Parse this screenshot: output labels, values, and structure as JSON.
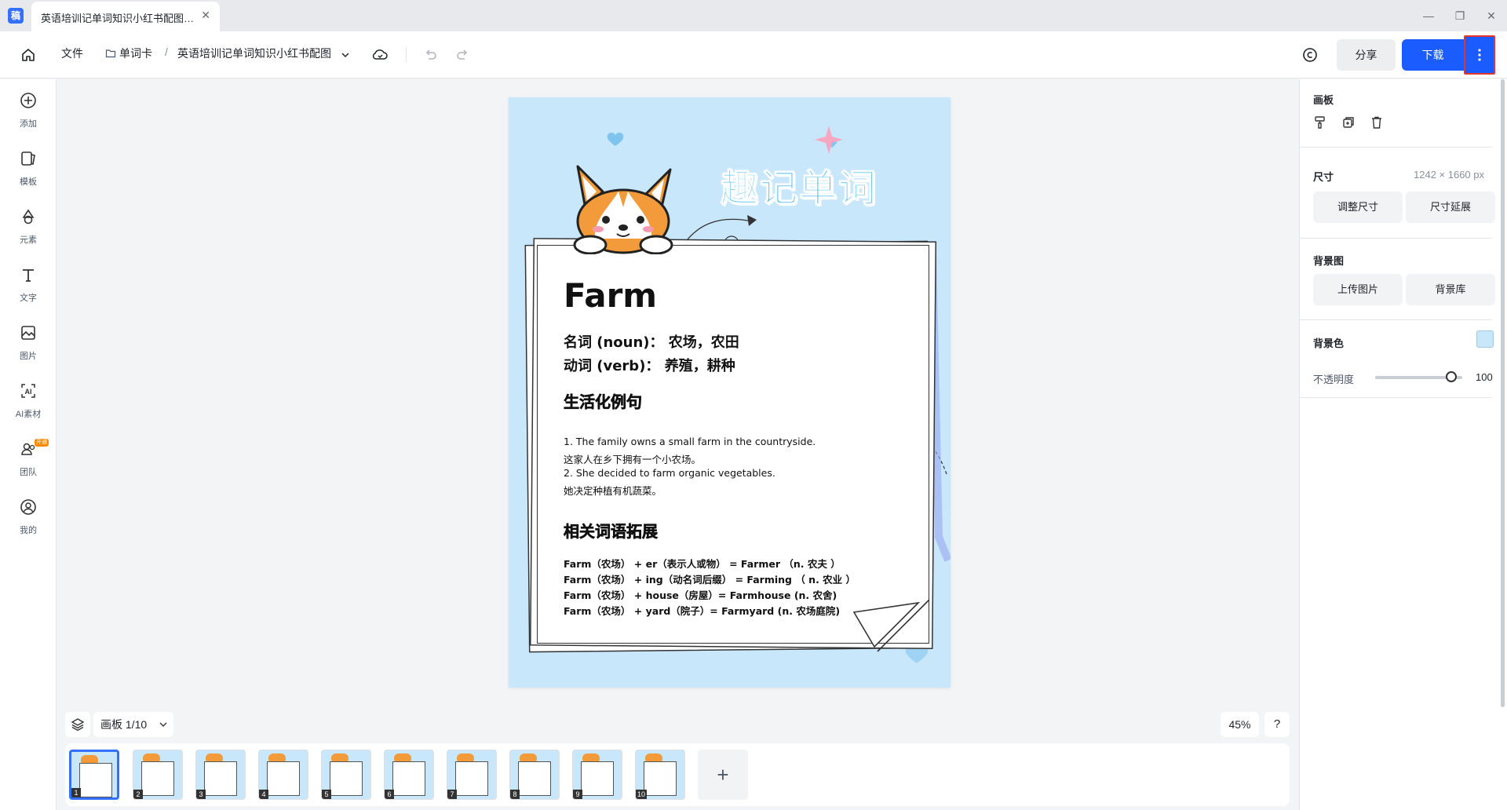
{
  "window": {
    "app_logo_text": "稿",
    "tab_title": "英语培训记单词知识小红书配图_...",
    "controls": [
      "—",
      "❐",
      "✕"
    ]
  },
  "toolbar": {
    "file_label": "文件",
    "breadcrumb_folder": "单词卡",
    "breadcrumb_sep": "/",
    "doc_name": "英语培训记单词知识小红书配图",
    "share_label": "分享",
    "download_label": "下载"
  },
  "left_rail": {
    "items": [
      {
        "label": "添加",
        "icon": "plus-circle-icon"
      },
      {
        "label": "模板",
        "icon": "template-icon"
      },
      {
        "label": "元素",
        "icon": "shapes-icon"
      },
      {
        "label": "文字",
        "icon": "text-icon"
      },
      {
        "label": "图片",
        "icon": "image-icon"
      },
      {
        "label": "AI素材",
        "icon": "ai-icon"
      },
      {
        "label": "团队",
        "icon": "team-icon"
      },
      {
        "label": "我的",
        "icon": "user-icon"
      }
    ],
    "team_badge": "开通"
  },
  "artboard": {
    "cn_title": "趣记单词",
    "word": "Farm",
    "def_noun": "名词 (noun)：  农场，农田",
    "def_verb": "动词 (verb)：  养殖，耕种",
    "examples_heading": "生活化例句",
    "examples": [
      "1. The family owns a small farm in the countryside.",
      "这家人在乡下拥有一个小农场。",
      "2. She decided to farm organic vegetables.",
      "她决定种植有机蔬菜。"
    ],
    "extension_heading": "相关词语拓展",
    "extensions": [
      "Farm（农场） + er（表示人或物） = Farmer  （n. 农夫 ）",
      "Farm（农场） + ing（动名词后缀） = Farming  （ n. 农业 ）",
      "Farm（农场） + house（房屋）= Farmhouse (n. 农舍)",
      "Farm（农场） + yard（院子）= Farmyard (n. 农场庭院)"
    ],
    "background_color": "#c9e7fb"
  },
  "bottom": {
    "board_selector": "画板 1/10",
    "zoom": "45%",
    "help": "?",
    "thumbnails": [
      "1",
      "2",
      "3",
      "4",
      "5",
      "6",
      "7",
      "8",
      "9",
      "10"
    ],
    "add_label": "+"
  },
  "right_panel": {
    "artboard_heading": "画板",
    "size_heading": "尺寸",
    "size_value": "1242 × 1660 px",
    "resize_btn": "调整尺寸",
    "extend_btn": "尺寸延展",
    "bg_image_heading": "背景图",
    "upload_btn": "上传图片",
    "library_btn": "背景库",
    "bg_color_heading": "背景色",
    "opacity_label": "不透明度",
    "opacity_value": "100",
    "bg_color": "#c9e7fb"
  }
}
